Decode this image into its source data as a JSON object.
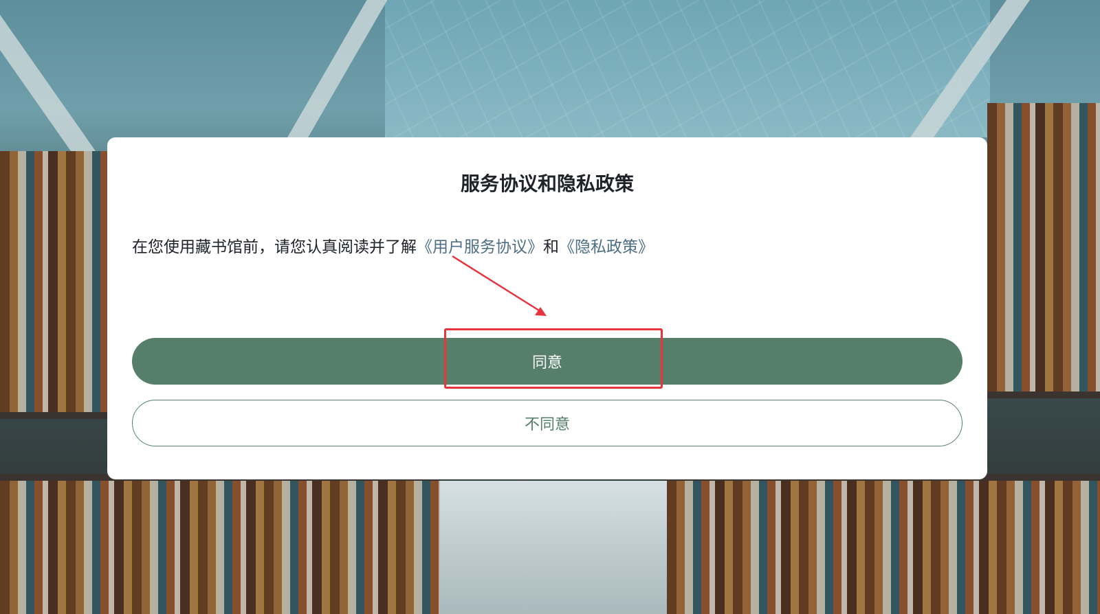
{
  "dialog": {
    "title": "服务协议和隐私政策",
    "message_prefix": "在您使用藏书馆前，请您认真阅读并了解",
    "service_link": "《用户服务协议》",
    "message_and": "和",
    "privacy_link": "《隐私政策》",
    "agree_label": "同意",
    "disagree_label": "不同意"
  },
  "colors": {
    "accent": "#557f6a",
    "link": "#4d6e83",
    "annotation": "#e8343c"
  },
  "annotation": {
    "target": "agree-button"
  }
}
